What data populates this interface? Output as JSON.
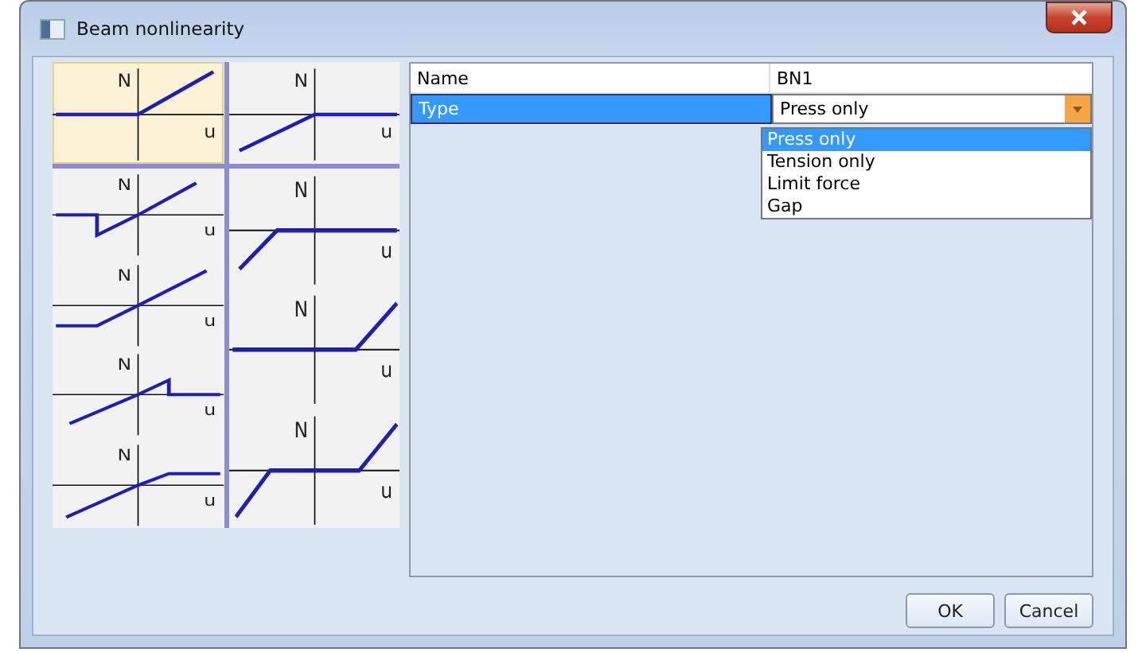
{
  "window": {
    "title": "Beam nonlinearity"
  },
  "diagrams": {
    "top_row": [
      {
        "kind": "flat-then-rise",
        "selected": true,
        "y_label": "N",
        "x_label": "u"
      },
      {
        "kind": "rise-then-flat",
        "selected": false,
        "y_label": "N",
        "x_label": "u"
      }
    ],
    "left_column": [
      {
        "kind": "drop-then-rise",
        "selected": false,
        "y_label": "N",
        "x_label": "u"
      },
      {
        "kind": "flat-then-linear",
        "selected": false,
        "y_label": "N",
        "x_label": "u"
      },
      {
        "kind": "linear-then-drop",
        "selected": false,
        "y_label": "N",
        "x_label": "u"
      },
      {
        "kind": "linear-then-cap",
        "selected": false,
        "y_label": "N",
        "x_label": "u"
      }
    ],
    "right_column": [
      {
        "kind": "early-kink-flat",
        "selected": false,
        "y_label": "N",
        "x_label": "u"
      },
      {
        "kind": "late-rise",
        "selected": false,
        "y_label": "N",
        "x_label": "u"
      },
      {
        "kind": "gap",
        "selected": false,
        "y_label": "N",
        "x_label": "u"
      }
    ]
  },
  "properties": [
    {
      "kind": "text",
      "name": "Name",
      "value": "BN1",
      "selected": false
    },
    {
      "kind": "dropdown",
      "name": "Type",
      "value": "Press only",
      "selected": true
    }
  ],
  "dropdown_options": [
    {
      "label": "Press only",
      "selected": true
    },
    {
      "label": "Tension only",
      "selected": false
    },
    {
      "label": "Limit force",
      "selected": false
    },
    {
      "label": "Gap",
      "selected": false
    }
  ],
  "buttons": [
    "OK",
    "Cancel"
  ]
}
